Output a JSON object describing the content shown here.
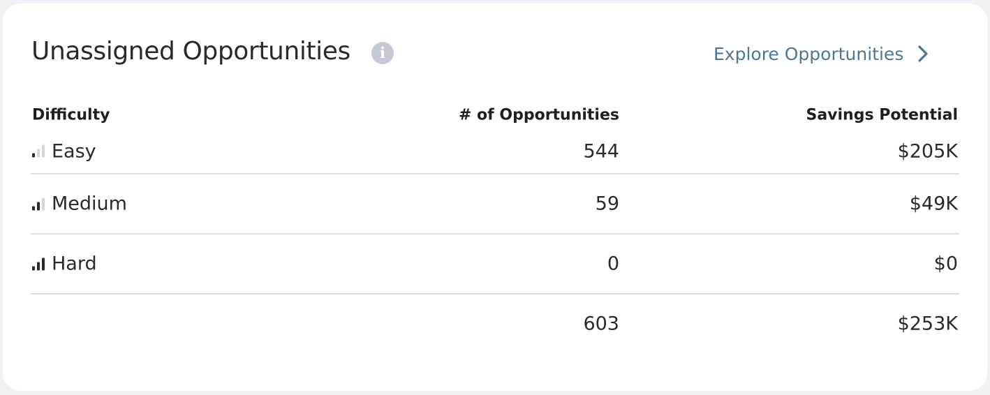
{
  "card": {
    "title": "Unassigned Opportunities",
    "info_icon": "info-icon",
    "explore_label": "Explore Opportunities",
    "explore_icon": "chevron-right-icon"
  },
  "table": {
    "headers": {
      "difficulty": "Difficulty",
      "count": "# of Opportunities",
      "savings": "Savings Potential"
    },
    "rows": [
      {
        "difficulty": "Easy",
        "level": 1,
        "count": "544",
        "savings": "$205K"
      },
      {
        "difficulty": "Medium",
        "level": 2,
        "count": "59",
        "savings": "$49K"
      },
      {
        "difficulty": "Hard",
        "level": 3,
        "count": "0",
        "savings": "$0"
      }
    ],
    "total": {
      "count": "603",
      "savings": "$253K"
    }
  },
  "colors": {
    "link": "#4a7797",
    "bar_active": "#2a2a2e",
    "bar_inactive": "#d4d6da",
    "divider": "#dde0e5"
  }
}
